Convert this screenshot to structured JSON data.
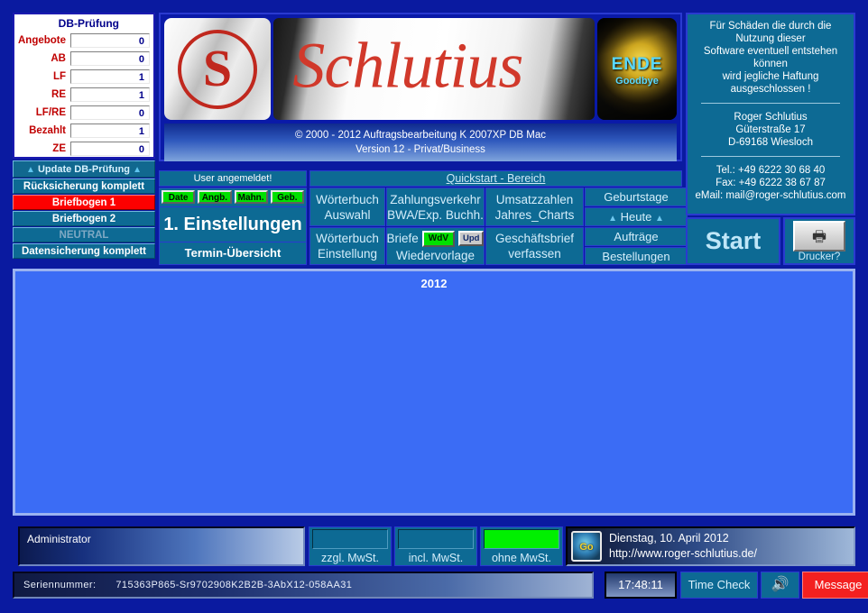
{
  "db_check": {
    "title": "DB-Prüfung",
    "rows": [
      {
        "label": "Angebote",
        "value": "0"
      },
      {
        "label": "AB",
        "value": "0"
      },
      {
        "label": "LF",
        "value": "1"
      },
      {
        "label": "RE",
        "value": "1"
      },
      {
        "label": "LF/RE",
        "value": "0"
      },
      {
        "label": "Bezahlt",
        "value": "1"
      },
      {
        "label": "ZE",
        "value": "0"
      }
    ]
  },
  "left_buttons": {
    "update": "Update DB-Prüfung",
    "arrow": "▲",
    "ruecksicherung": "Rücksicherung komplett",
    "briefbogen1": "Briefbogen 1",
    "briefbogen2": "Briefbogen 2",
    "neutral": "NEUTRAL",
    "datensicherung": "Datensicherung komplett"
  },
  "banner": {
    "logo_letter": "S",
    "script": "Schlutius",
    "end_title": "ENDE",
    "end_sub": "Goodbye",
    "copyright": "© 2000 - 2012 Auftragsbearbeitung K 2007XP DB Mac",
    "version": "Version 12 - Privat/Business"
  },
  "quickstart": {
    "user_status": "User angemeldet!",
    "title": "Quickstart - Bereich",
    "mini_buttons": [
      "Date",
      "Angb.",
      "Mahn.",
      "Geb."
    ],
    "einstellungen": "1. Einstellungen",
    "termin": "Termin-Übersicht",
    "woerterbuch_auswahl": "Wörterbuch\nAuswahl",
    "woerterbuch_auswahl_l1": "Wörterbuch",
    "woerterbuch_auswahl_l2": "Auswahl",
    "zahlungsverkehr_l1": "Zahlungsverkehr",
    "zahlungsverkehr_l2": "BWA/Exp. Buchh.",
    "umsatzzahlen_l1": "Umsatzzahlen",
    "umsatzzahlen_l2": "Jahres_Charts",
    "woerterbuch_einst_l1": "Wörterbuch",
    "woerterbuch_einst_l2": "Einstellung",
    "briefe_label": "Briefe",
    "badge_wdv": "WdV",
    "badge_upd": "Upd",
    "wiedervorlage": "Wiedervorlage",
    "geschaeftsbrief_l1": "Geschäftsbrief",
    "geschaeftsbrief_l2": "verfassen",
    "geburtstage": "Geburtstage",
    "heute": "Heute",
    "heute_arrow": "▲",
    "auftraege": "Aufträge",
    "bestellungen": "Bestellungen"
  },
  "info_panel": {
    "disclaimer_l1": "Für Schäden die durch die",
    "disclaimer_l2": "Nutzung dieser",
    "disclaimer_l3": "Software eventuell entstehen",
    "disclaimer_l4": "können",
    "disclaimer_l5": "wird jegliche Haftung",
    "disclaimer_l6": "ausgeschlossen !",
    "name": "Roger Schlutius",
    "street": "Güterstraße 17",
    "city": "D-69168 Wiesloch",
    "tel": "Tel.: +49 6222 30 68 40",
    "fax": "Fax: +49 6222 38 67 87",
    "email": "eMail: mail@roger-schlutius.com"
  },
  "actions": {
    "start": "Start",
    "drucker": "Drucker?",
    "printer_glyph": "🖶"
  },
  "main": {
    "year": "2012"
  },
  "lower": {
    "admin": "Administrator",
    "mwst": [
      {
        "label": "zzgl. MwSt.",
        "active": false
      },
      {
        "label": "incl. MwSt.",
        "active": false
      },
      {
        "label": "ohne MwSt.",
        "active": true
      }
    ],
    "date": "Dienstag, 10. April 2012",
    "url": "http://www.roger-schlutius.de/"
  },
  "status_bar": {
    "serial_label": "Seriennummer:",
    "serial_value": "715363P865-Sr9702908K2B2B-3AbX12-058AA31",
    "clock": "17:48:11",
    "time_check": "Time Check",
    "sound_glyph": "🔊",
    "message": "Message"
  },
  "colors": {
    "frame": "#0a1aa0",
    "teal": "#0d6a94",
    "red": "#fd0000",
    "green": "#00e000",
    "main_blue": "#3b6cf5"
  }
}
